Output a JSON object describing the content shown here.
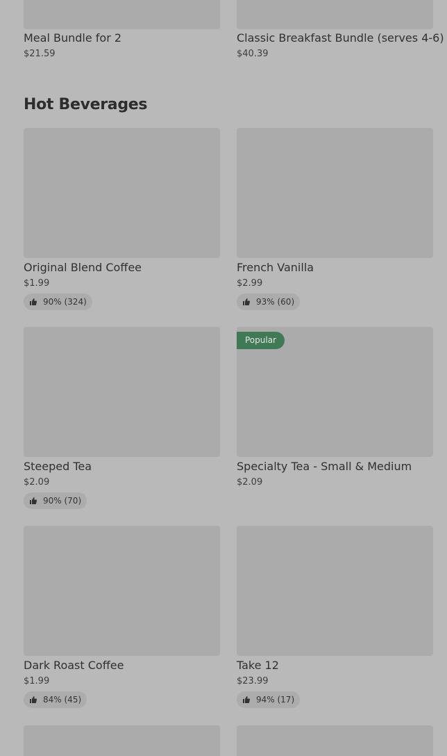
{
  "bundles": [
    {
      "name": "Meal Bundle for 2",
      "price": "$21.59"
    },
    {
      "name": "Classic Breakfast Bundle (serves 4-6)",
      "price": "$40.39"
    }
  ],
  "section": {
    "title": "Hot Beverages"
  },
  "products": [
    {
      "name": "Original Blend Coffee",
      "price": "$1.99",
      "rating": "90% (324)"
    },
    {
      "name": "French Vanilla",
      "price": "$2.99",
      "rating": "93% (60)"
    },
    {
      "name": "Steeped Tea",
      "price": "$2.09",
      "rating": "90% (70)"
    },
    {
      "name": "Specialty Tea - Small & Medium",
      "price": "$2.09",
      "badge": "Popular"
    },
    {
      "name": "Dark Roast Coffee",
      "price": "$1.99",
      "rating": "84% (45)"
    },
    {
      "name": "Take 12",
      "price": "$23.99",
      "rating": "94% (17)"
    }
  ],
  "icons": {
    "rating": "thumbs-up-icon"
  },
  "colors": {
    "badge": "#3f7a55",
    "background": "#b9b9b9",
    "placeholder": "#ababab"
  }
}
